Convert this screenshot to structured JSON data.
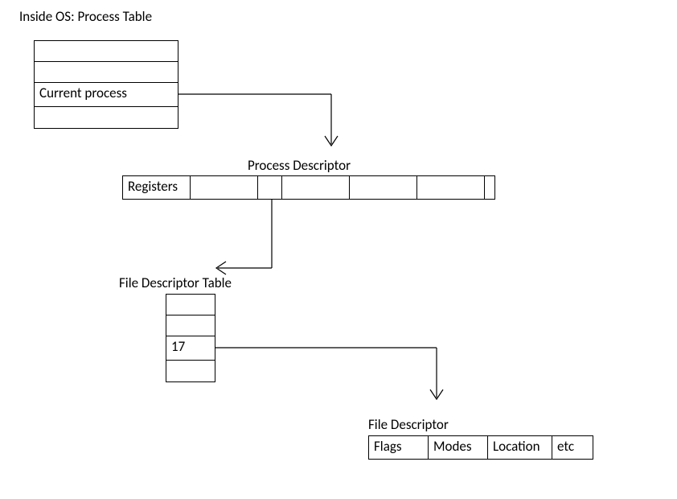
{
  "title": "Inside OS: Process Table",
  "process_table": {
    "rows": [
      "",
      "",
      "Current process",
      ""
    ]
  },
  "process_descriptor": {
    "label": "Process Descriptor",
    "cells": [
      "Registers",
      "",
      "",
      "",
      "",
      "",
      ""
    ]
  },
  "fd_table": {
    "label": "File Descriptor Table",
    "rows": [
      "",
      "",
      "17",
      ""
    ]
  },
  "file_descriptor": {
    "label": "File Descriptor",
    "cells": [
      "Flags",
      "Modes",
      "Location",
      "etc"
    ]
  }
}
